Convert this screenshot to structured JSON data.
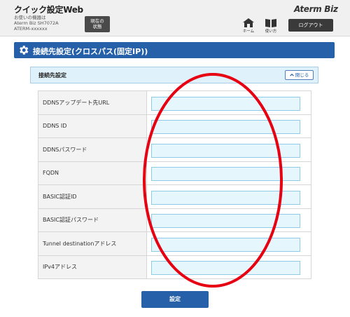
{
  "header": {
    "app_title": "クイック設定Web",
    "device_lines": [
      "お使いの機器は",
      "Aterm Biz SH7072A",
      "ATERM-xxxxxx"
    ],
    "status_button": [
      "現在の",
      "状態"
    ],
    "brand": "Aterm Biz",
    "nav": [
      {
        "label": "ホーム",
        "icon": "home-icon"
      },
      {
        "label": "使い方",
        "icon": "book-icon"
      }
    ],
    "logout_label": "ログアウト"
  },
  "section": {
    "title": "接続先設定(クロスパス(固定IP))",
    "icon": "gear-icon"
  },
  "panel": {
    "title": "接続先設定",
    "close_label": "閉じる",
    "close_icon": "chevron-up-icon"
  },
  "form": {
    "rows": [
      {
        "label": "DDNSアップデート先URL",
        "value": ""
      },
      {
        "label": "DDNS ID",
        "value": ""
      },
      {
        "label": "DDNSパスワード",
        "value": ""
      },
      {
        "label": "FQDN",
        "value": ""
      },
      {
        "label": "BASIC認証ID",
        "value": ""
      },
      {
        "label": "BASIC認証パスワード",
        "value": ""
      },
      {
        "label": "Tunnel destinationアドレス",
        "value": ""
      },
      {
        "label": "IPv4アドレス",
        "value": ""
      }
    ]
  },
  "submit_label": "設定",
  "colors": {
    "primary": "#2560a8",
    "panel_bg": "#dff1fb",
    "input_bg": "#e6f6fd",
    "annotation": "#e60012"
  }
}
